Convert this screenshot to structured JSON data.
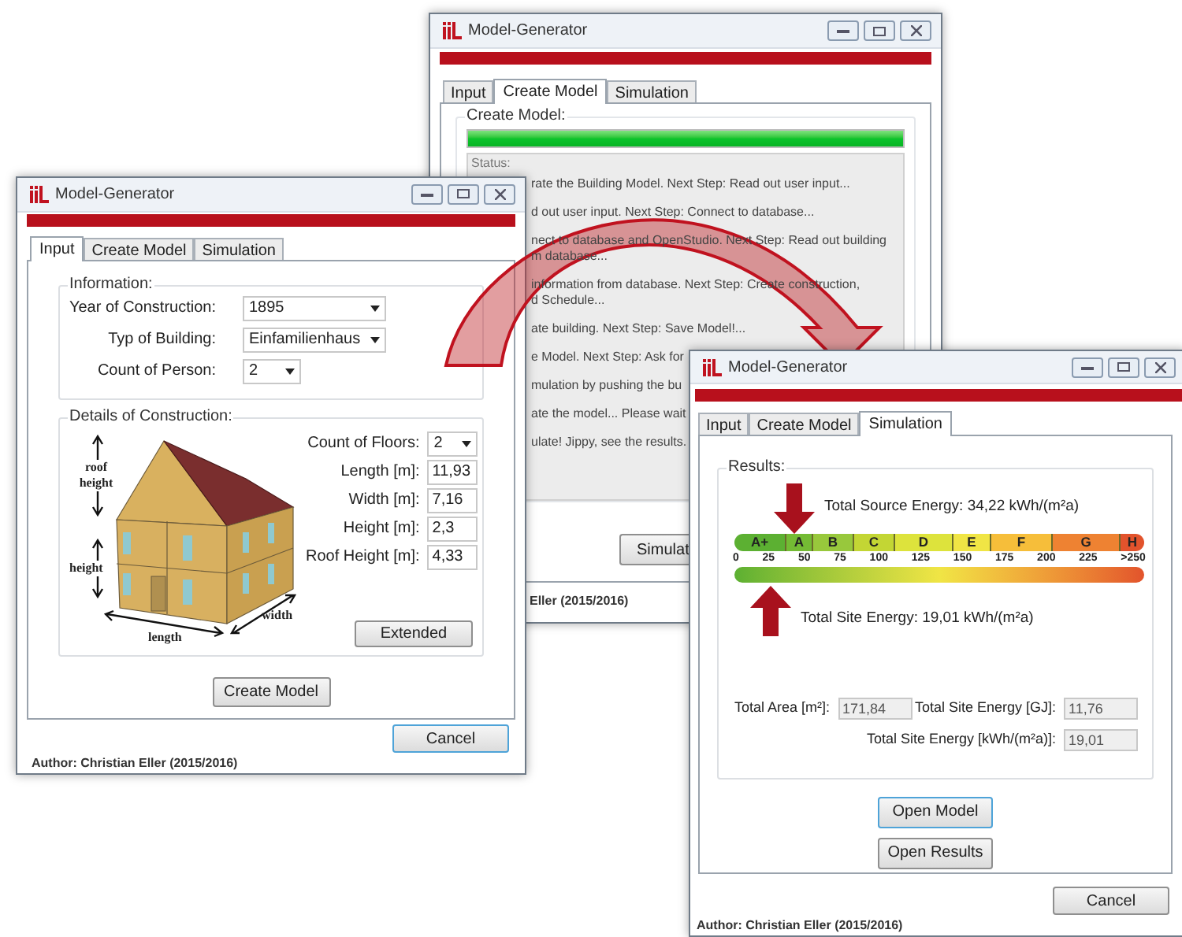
{
  "back_window": {
    "title": "Model-Generator",
    "tabs": [
      {
        "label": "Input",
        "selected": false
      },
      {
        "label": "Create Model",
        "selected": true
      },
      {
        "label": "Simulation",
        "selected": false
      }
    ],
    "group_title": "Create Model:",
    "progress": {
      "level": 1
    },
    "status_title": "Status:",
    "status_entries": [
      {
        "lines": [
          "rate the Building Model. Next Step: Read out user input..."
        ]
      },
      {
        "lines": [
          "d out user input. Next Step: Connect to database..."
        ]
      },
      {
        "lines": [
          "nect to database and OpenStudio. Next Step: Read out building",
          "m database..."
        ]
      },
      {
        "lines": [
          "information from database. Next Step: Create construction,",
          "d Schedule..."
        ]
      },
      {
        "lines": [
          "ate building. Next Step: Save Model!..."
        ]
      },
      {
        "lines": [
          "e Model. Next Step: Ask for"
        ]
      },
      {
        "lines": [
          "mulation by pushing the bu"
        ]
      },
      {
        "lines": [
          "ate the model... Please wait"
        ]
      },
      {
        "lines": [
          "ulate! Jippy, see the results."
        ]
      }
    ],
    "simulate_button": "Simulat",
    "author": "Eller (2015/2016)"
  },
  "input_window": {
    "title": "Model-Generator",
    "tabs": [
      {
        "label": "Input",
        "selected": true
      },
      {
        "label": "Create Model",
        "selected": false
      },
      {
        "label": "Simulation",
        "selected": false
      }
    ],
    "information": {
      "title": "Information:",
      "fields": [
        {
          "label": "Year of Construction:",
          "value": "1895",
          "kind": "dropdown"
        },
        {
          "label": "Typ of Building:",
          "value": "Einfamilienhaus",
          "kind": "dropdown"
        },
        {
          "label": "Count of Person:",
          "value": "2",
          "kind": "small_dropdown"
        }
      ]
    },
    "details": {
      "title": "Details of Construction:",
      "diagram_labels": {
        "roof_height": "roof height",
        "height": "height",
        "length": "length",
        "width": "width"
      },
      "fields": [
        {
          "label": "Count of Floors:",
          "value": "2",
          "kind": "dropdown"
        },
        {
          "label": "Length [m]:",
          "value": "11,93",
          "kind": "text"
        },
        {
          "label": "Width [m]:",
          "value": "7,16",
          "kind": "text"
        },
        {
          "label": "Height [m]:",
          "value": "2,3",
          "kind": "text"
        },
        {
          "label": "Roof Height [m]:",
          "value": "4,33",
          "kind": "text"
        }
      ],
      "extended_button": "Extended"
    },
    "create_button": "Create Model",
    "cancel_button": {
      "label": "Cancel",
      "focused": true
    },
    "author": "Author: Christian Eller (2015/2016)"
  },
  "simulation_window": {
    "title": "Model-Generator",
    "tabs": [
      {
        "label": "Input",
        "selected": false
      },
      {
        "label": "Create Model",
        "selected": false
      },
      {
        "label": "Simulation",
        "selected": true
      }
    ],
    "results_title": "Results:",
    "source_energy": "Total Source Energy: 34,22 kWh/(m²a)",
    "site_energy": "Total Site Energy: 19,01 kWh/(m²a)",
    "scale_classes": [
      {
        "label": "A+",
        "color": "#5cb032"
      },
      {
        "label": "A",
        "color": "#74bb34"
      },
      {
        "label": "B",
        "color": "#98c83c"
      },
      {
        "label": "C",
        "color": "#c3d634"
      },
      {
        "label": "D",
        "color": "#dde33c"
      },
      {
        "label": "E",
        "color": "#f0e545"
      },
      {
        "label": "F",
        "color": "#f6be3a"
      },
      {
        "label": "G",
        "color": "#ee8232"
      },
      {
        "label": "H",
        "color": "#e2532c"
      }
    ],
    "scale_ticks": [
      "0",
      "25",
      "50",
      "75",
      "100",
      "125",
      "150",
      "175",
      "200",
      "225",
      ">250"
    ],
    "fields": [
      {
        "label": "Total Area [m²]:",
        "value": "171,84",
        "disabled": true
      },
      {
        "label": "Total Site Energy [GJ]:",
        "value": "11,76",
        "disabled": true
      },
      {
        "label": "Total Site Energy [kWh/(m²a)]:",
        "value": "19,01",
        "disabled": true
      }
    ],
    "buttons": [
      {
        "label": "Open Model",
        "focused": true
      },
      {
        "label": "Open Results",
        "focused": false
      }
    ],
    "cancel_button": {
      "label": "Cancel",
      "focused": false
    },
    "author": "Author: Christian Eller (2015/2016)"
  }
}
